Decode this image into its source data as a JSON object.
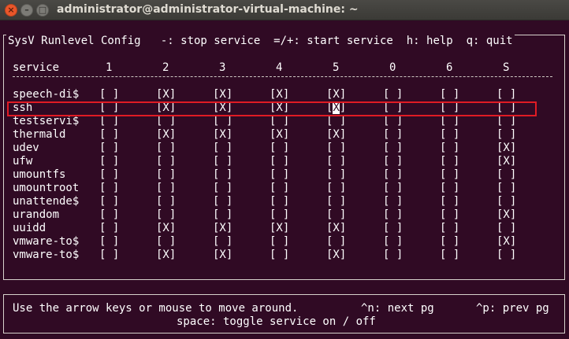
{
  "window": {
    "title": "administrator@administrator-virtual-machine: ~",
    "close_glyph": "×",
    "min_glyph": "–",
    "max_glyph": "□"
  },
  "app": {
    "title": "SysV Runlevel Config   -: stop service  =/+: start service  h: help  q: quit"
  },
  "table": {
    "header_service": "service",
    "runlevels": [
      "1",
      "2",
      "3",
      "4",
      "5",
      "0",
      "6",
      "S"
    ],
    "selected_row": 1,
    "rows": [
      {
        "name": "speech-di$",
        "cells": [
          "[ ]",
          "[X]",
          "[X]",
          "[X]",
          "[X]",
          "[ ]",
          "[ ]",
          "[ ]"
        ]
      },
      {
        "name": "ssh",
        "cells": [
          "[ ]",
          "[X]",
          "[X]",
          "[X]",
          "[X]",
          "[ ]",
          "[ ]",
          "[ ]"
        ]
      },
      {
        "name": "testservi$",
        "cells": [
          "[ ]",
          "[ ]",
          "[ ]",
          "[ ]",
          "[ ]",
          "[ ]",
          "[ ]",
          "[ ]"
        ]
      },
      {
        "name": "thermald",
        "cells": [
          "[ ]",
          "[X]",
          "[X]",
          "[X]",
          "[X]",
          "[ ]",
          "[ ]",
          "[ ]"
        ]
      },
      {
        "name": "udev",
        "cells": [
          "[ ]",
          "[ ]",
          "[ ]",
          "[ ]",
          "[ ]",
          "[ ]",
          "[ ]",
          "[X]"
        ]
      },
      {
        "name": "ufw",
        "cells": [
          "[ ]",
          "[ ]",
          "[ ]",
          "[ ]",
          "[ ]",
          "[ ]",
          "[ ]",
          "[X]"
        ]
      },
      {
        "name": "umountfs",
        "cells": [
          "[ ]",
          "[ ]",
          "[ ]",
          "[ ]",
          "[ ]",
          "[ ]",
          "[ ]",
          "[ ]"
        ]
      },
      {
        "name": "umountroot",
        "cells": [
          "[ ]",
          "[ ]",
          "[ ]",
          "[ ]",
          "[ ]",
          "[ ]",
          "[ ]",
          "[ ]"
        ]
      },
      {
        "name": "unattende$",
        "cells": [
          "[ ]",
          "[ ]",
          "[ ]",
          "[ ]",
          "[ ]",
          "[ ]",
          "[ ]",
          "[ ]"
        ]
      },
      {
        "name": "urandom",
        "cells": [
          "[ ]",
          "[ ]",
          "[ ]",
          "[ ]",
          "[ ]",
          "[ ]",
          "[ ]",
          "[X]"
        ]
      },
      {
        "name": "uuidd",
        "cells": [
          "[ ]",
          "[X]",
          "[X]",
          "[X]",
          "[X]",
          "[ ]",
          "[ ]",
          "[ ]"
        ]
      },
      {
        "name": "vmware-to$",
        "cells": [
          "[ ]",
          "[ ]",
          "[ ]",
          "[ ]",
          "[ ]",
          "[ ]",
          "[ ]",
          "[X]"
        ]
      },
      {
        "name": "vmware-to$",
        "cells": [
          "[ ]",
          "[X]",
          "[X]",
          "[ ]",
          "[X]",
          "[ ]",
          "[ ]",
          "[ ]"
        ]
      }
    ]
  },
  "help": {
    "line1_left": "Use the arrow keys or mouse to move around.",
    "line1_next": "^n: next pg",
    "line1_prev": "^p: prev pg",
    "line2": "space: toggle service on / off"
  },
  "colors": {
    "terminal_bg": "#300a24",
    "highlight": "#e01b24"
  }
}
